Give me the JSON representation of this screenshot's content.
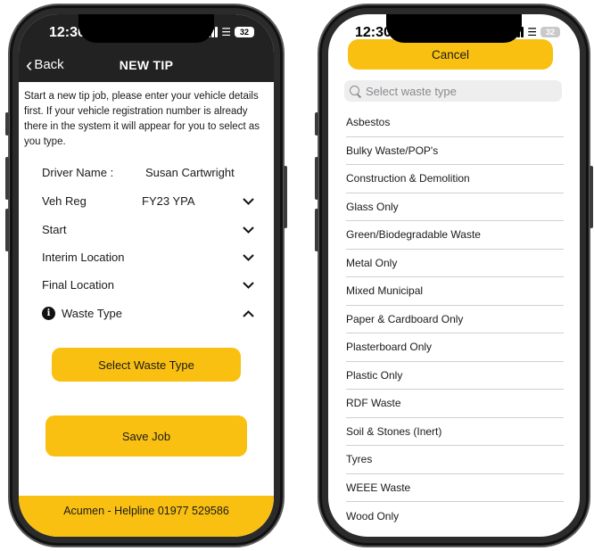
{
  "left_phone": {
    "status_bar": {
      "time": "12:30",
      "battery": "32"
    },
    "header": {
      "back_label": "Back",
      "title": "NEW TIP"
    },
    "intro_text": "Start a new tip job, please enter your vehicle details first. If your vehicle registration number is already there in the system it will appear for you to select as you type.",
    "form": {
      "driver_label": "Driver Name :",
      "driver_value": "Susan Cartwright",
      "veh_reg_label": "Veh Reg",
      "veh_reg_value": "FY23 YPA",
      "start_label": "Start",
      "interim_label": "Interim Location",
      "final_label": "Final Location",
      "waste_type_label": "Waste Type"
    },
    "select_waste_label": "Select Waste Type",
    "save_job_label": "Save Job",
    "footer_text": "Acumen - Helpline 01977 529586"
  },
  "right_phone": {
    "status_bar": {
      "time": "12:30",
      "battery": "32"
    },
    "cancel_label": "Cancel",
    "search_placeholder": "Select waste type",
    "waste_types": [
      "Asbestos",
      "Bulky Waste/POP's",
      "Construction & Demolition",
      "Glass Only",
      "Green/Biodegradable Waste",
      "Metal Only",
      "Mixed Municipal",
      "Paper & Cardboard Only",
      "Plasterboard Only",
      "Plastic Only",
      "RDF Waste",
      "Soil & Stones (Inert)",
      "Tyres",
      "WEEE Waste",
      "Wood Only"
    ]
  },
  "colors": {
    "accent_yellow": "#f9c012",
    "header_dark": "#222222",
    "phone_frame": "#2b2b2b"
  },
  "icons": {
    "back": "chevron-left-icon",
    "collapsed": "chevron-down-icon",
    "expanded": "chevron-up-icon",
    "info": "info-icon",
    "search": "search-icon"
  }
}
